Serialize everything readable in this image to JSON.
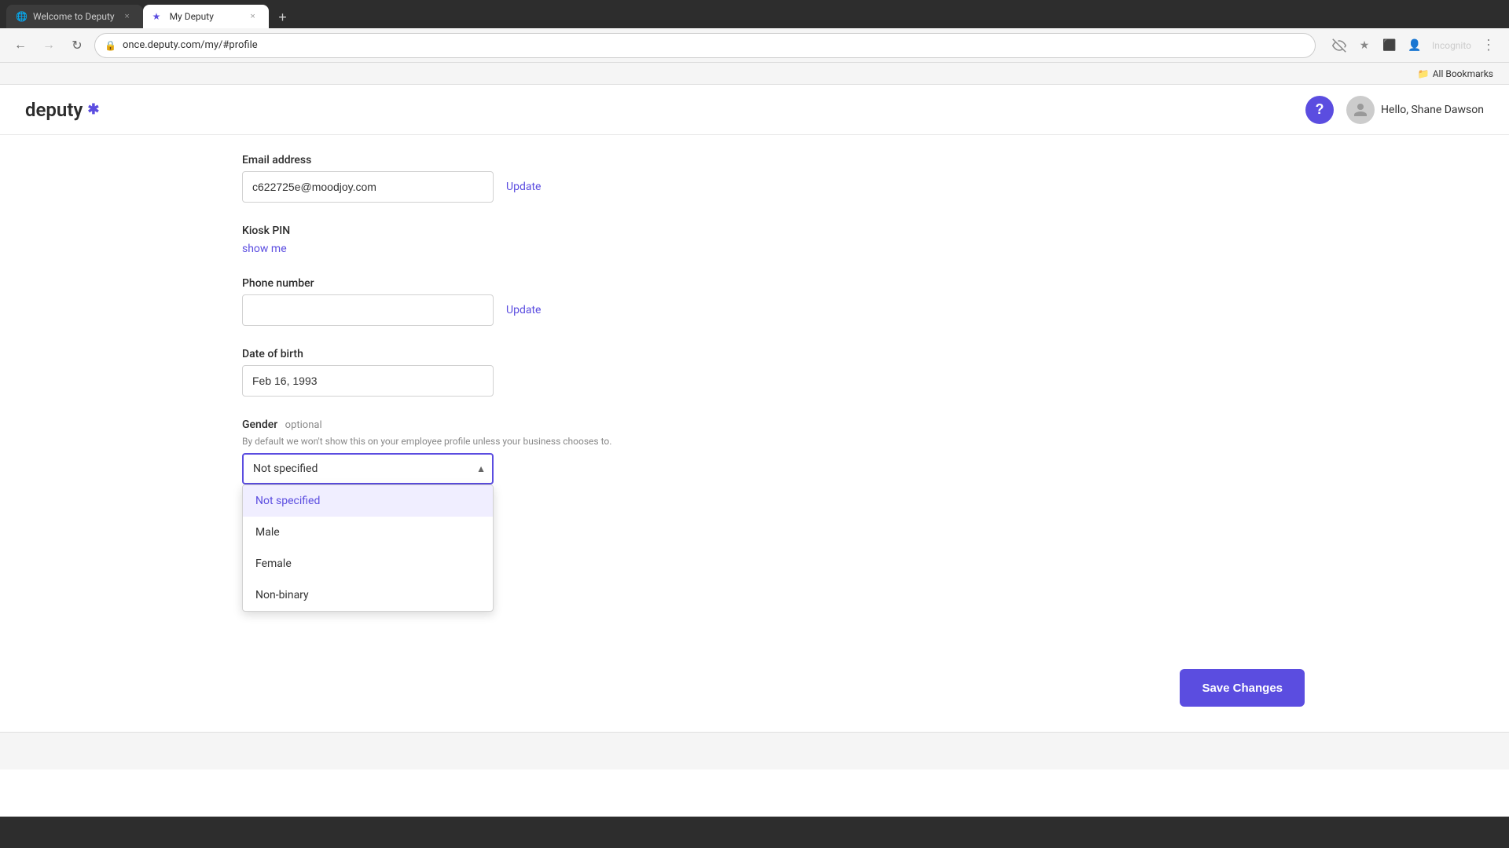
{
  "browser": {
    "tabs": [
      {
        "id": "tab1",
        "title": "Welcome to Deputy",
        "favicon": "🌐",
        "active": false,
        "closable": true
      },
      {
        "id": "tab2",
        "title": "My Deputy",
        "favicon": "⭐",
        "active": true,
        "closable": true
      }
    ],
    "new_tab_label": "+",
    "url": "once.deputy.com/my/#profile",
    "back_disabled": false,
    "forward_disabled": true,
    "incognito_label": "Incognito",
    "bookmarks_label": "All Bookmarks"
  },
  "header": {
    "logo_text": "deputy",
    "logo_star": "✱",
    "help_label": "?",
    "user_greeting": "Hello, Shane Dawson"
  },
  "form": {
    "email_label": "Email address",
    "email_value": "c622725e@moodjoy.com",
    "email_update_link": "Update",
    "kiosk_label": "Kiosk PIN",
    "kiosk_show_link": "show me",
    "phone_label": "Phone number",
    "phone_value": "",
    "phone_placeholder": "",
    "phone_update_link": "Update",
    "dob_label": "Date of birth",
    "dob_value": "Feb 16, 1993",
    "gender_label": "Gender",
    "gender_optional": "optional",
    "gender_hint": "By default we won't show this on your employee profile unless your business chooses to.",
    "gender_selected": "Not specified",
    "gender_options": [
      {
        "value": "not_specified",
        "label": "Not specified",
        "selected": true
      },
      {
        "value": "male",
        "label": "Male",
        "selected": false
      },
      {
        "value": "female",
        "label": "Female",
        "selected": false
      },
      {
        "value": "non_binary",
        "label": "Non-binary",
        "selected": false
      }
    ]
  },
  "actions": {
    "save_label": "Save Changes"
  }
}
